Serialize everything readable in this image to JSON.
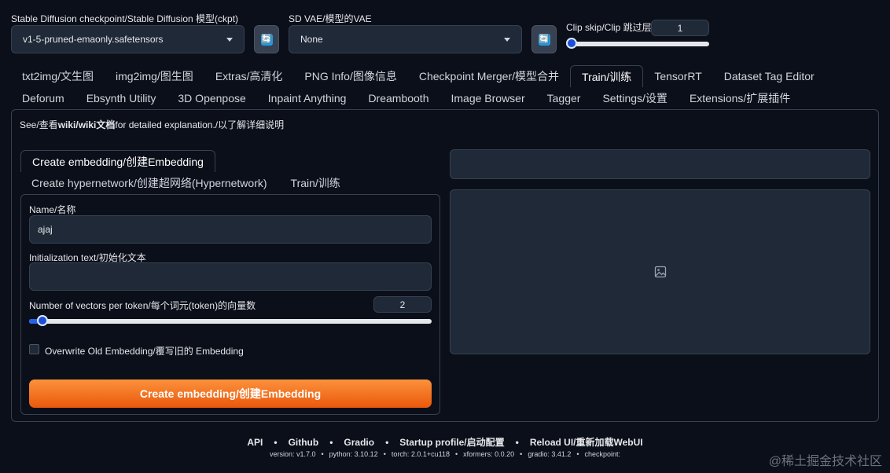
{
  "top": {
    "checkpoint": {
      "label": "Stable Diffusion checkpoint/Stable Diffusion 模型(ckpt)",
      "value": "v1-5-pruned-emaonly.safetensors"
    },
    "vae": {
      "label": "SD VAE/模型的VAE",
      "value": "None"
    },
    "clip_skip": {
      "label": "Clip skip/Clip 跳过层",
      "value": "1",
      "fraction": 0.0
    },
    "refresh_glyph": "🔄"
  },
  "tabs_row1": [
    "txt2img/文生图",
    "img2img/图生图",
    "Extras/高清化",
    "PNG Info/图像信息",
    "Checkpoint Merger/模型合并",
    "Train/训练",
    "TensorRT",
    "Dataset Tag Editor"
  ],
  "tabs_row2": [
    "Deforum",
    "Ebsynth Utility",
    "3D Openpose",
    "Inpaint Anything",
    "Dreambooth",
    "Image Browser",
    "Tagger",
    "Settings/设置",
    "Extensions/扩展插件"
  ],
  "help_text": {
    "prefix": "See/查看",
    "link": "wiki/wiki文档",
    "suffix": "for detailed explanation./以了解详细说明"
  },
  "subtabs": [
    "Create embedding/创建Embedding",
    "Create hypernetwork/创建超网络(Hypernetwork)",
    "Train/训练"
  ],
  "form": {
    "name_label": "Name/名称",
    "name_value": "ajaj",
    "init_label": "Initialization text/初始化文本",
    "init_value": "",
    "vectors_label": "Number of vectors per token/每个词元(token)的向量数",
    "vectors_value": "2",
    "vectors_fraction": 0.02,
    "overwrite_label": "Overwrite Old Embedding/覆写旧的 Embedding",
    "create_button": "Create embedding/创建Embedding"
  },
  "footer": {
    "links": [
      "API",
      "Github",
      "Gradio",
      "Startup profile/启动配置",
      "Reload UI/重新加载WebUI"
    ],
    "versions": [
      "version: v1.7.0",
      "python: 3.10.12",
      "torch: 2.0.1+cu118",
      "xformers: 0.0.20",
      "gradio: 3.41.2",
      "checkpoint:"
    ],
    "sep": "•"
  },
  "watermark": "@稀土掘金技术社区",
  "colors": {
    "accent": "#ea580c",
    "slider": "#2563eb",
    "background": "#0b0f19"
  }
}
